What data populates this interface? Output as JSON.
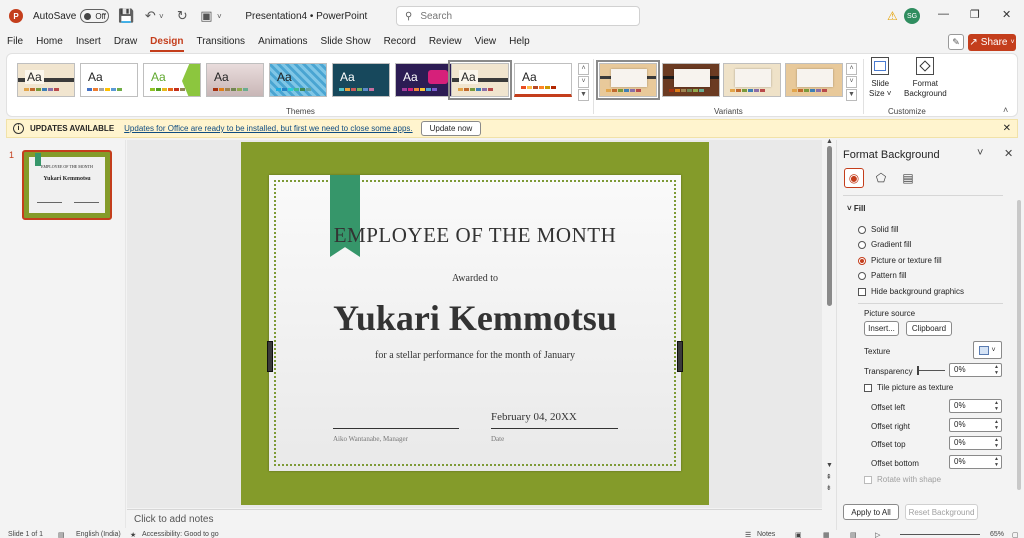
{
  "titlebar": {
    "app_logo_letter": "P",
    "autosave_label": "AutoSave",
    "autosave_state": "Off",
    "doc_title": "Presentation4  •  PowerPoint",
    "search_placeholder": "Search",
    "avatar_initials": "SG"
  },
  "menu": {
    "tabs": [
      "File",
      "Home",
      "Insert",
      "Draw",
      "Design",
      "Transitions",
      "Animations",
      "Slide Show",
      "Record",
      "Review",
      "View",
      "Help"
    ],
    "active_tab": "Design",
    "share_label": "Share"
  },
  "ribbon": {
    "themes_label": "Themes",
    "variants_label": "Variants",
    "customize_label": "Customize",
    "slide_size_label1": "Slide",
    "slide_size_label2": "Size",
    "format_bg_label1": "Format",
    "format_bg_label2": "Background",
    "theme_sample_text": "Aa"
  },
  "updates": {
    "title": "UPDATES AVAILABLE",
    "message": "Updates for Office are ready to be installed, but first we need to close some apps.",
    "button": "Update now"
  },
  "slides_panel": {
    "slide_number": "1",
    "thumb_title": "EMPLOYEE OF THE MONTH",
    "thumb_name": "Yukari Kemmotsu"
  },
  "slide": {
    "title": "EMPLOYEE OF THE MONTH",
    "awarded_to": "Awarded to",
    "name": "Yukari Kemmotsu",
    "reason": "for a stellar performance for the month of January",
    "date": "February 04, 20XX",
    "signer": "Aiko Wantanabe, Manager",
    "date_label": "Date"
  },
  "notes_placeholder": "Click to add notes",
  "format_pane": {
    "title": "Format Background",
    "section": "Fill",
    "options": [
      "Solid fill",
      "Gradient fill",
      "Picture or texture fill",
      "Pattern fill"
    ],
    "selected_option": "Picture or texture fill",
    "hide_graphics": "Hide background graphics",
    "picture_source": "Picture source",
    "insert_btn": "Insert...",
    "clipboard_btn": "Clipboard",
    "texture_label": "Texture",
    "transparency_label": "Transparency",
    "transparency_value": "0%",
    "tile_label": "Tile picture as texture",
    "offset_left_label": "Offset left",
    "offset_left_value": "0%",
    "offset_right_label": "Offset right",
    "offset_right_value": "0%",
    "offset_top_label": "Offset top",
    "offset_top_value": "0%",
    "offset_bottom_label": "Offset bottom",
    "offset_bottom_value": "0%",
    "rotate_label": "Rotate with shape",
    "apply_all": "Apply to All",
    "reset_bg": "Reset Background"
  },
  "statusbar": {
    "slide_info": "Slide 1 of 1",
    "language": "English (India)",
    "accessibility": "Accessibility: Good to go",
    "notes": "Notes",
    "zoom": "65%"
  },
  "colors": {
    "accent": "#c43e1c",
    "slide_bg": "#849b2a",
    "bookmark": "#36966a",
    "update_bar": "#fff4ce"
  }
}
